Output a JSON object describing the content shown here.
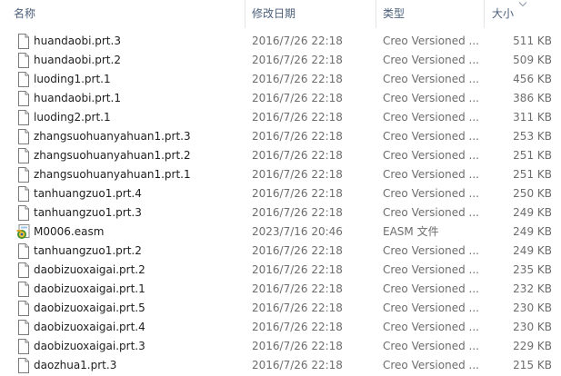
{
  "columns": {
    "name": "名称",
    "date": "修改日期",
    "type": "类型",
    "size": "大小"
  },
  "files": [
    {
      "name": "huandaobi.prt.3",
      "date": "2016/7/26 22:18",
      "type": "Creo Versioned ...",
      "size": "511 KB",
      "icon": "document-icon"
    },
    {
      "name": "huandaobi.prt.2",
      "date": "2016/7/26 22:18",
      "type": "Creo Versioned ...",
      "size": "509 KB",
      "icon": "document-icon"
    },
    {
      "name": "luoding1.prt.1",
      "date": "2016/7/26 22:18",
      "type": "Creo Versioned ...",
      "size": "456 KB",
      "icon": "document-icon"
    },
    {
      "name": "huandaobi.prt.1",
      "date": "2016/7/26 22:18",
      "type": "Creo Versioned ...",
      "size": "386 KB",
      "icon": "document-icon"
    },
    {
      "name": "luoding2.prt.1",
      "date": "2016/7/26 22:18",
      "type": "Creo Versioned ...",
      "size": "311 KB",
      "icon": "document-icon"
    },
    {
      "name": "zhangsuohuanyahuan1.prt.3",
      "date": "2016/7/26 22:18",
      "type": "Creo Versioned ...",
      "size": "253 KB",
      "icon": "document-icon"
    },
    {
      "name": "zhangsuohuanyahuan1.prt.2",
      "date": "2016/7/26 22:18",
      "type": "Creo Versioned ...",
      "size": "251 KB",
      "icon": "document-icon"
    },
    {
      "name": "zhangsuohuanyahuan1.prt.1",
      "date": "2016/7/26 22:18",
      "type": "Creo Versioned ...",
      "size": "251 KB",
      "icon": "document-icon"
    },
    {
      "name": "tanhuangzuo1.prt.4",
      "date": "2016/7/26 22:18",
      "type": "Creo Versioned ...",
      "size": "250 KB",
      "icon": "document-icon"
    },
    {
      "name": "tanhuangzuo1.prt.3",
      "date": "2016/7/26 22:18",
      "type": "Creo Versioned ...",
      "size": "249 KB",
      "icon": "document-icon"
    },
    {
      "name": "M0006.easm",
      "date": "2023/7/16 20:46",
      "type": "EASM 文件",
      "size": "249 KB",
      "icon": "easm-file-icon"
    },
    {
      "name": "tanhuangzuo1.prt.2",
      "date": "2016/7/26 22:18",
      "type": "Creo Versioned ...",
      "size": "249 KB",
      "icon": "document-icon"
    },
    {
      "name": "daobizuoxaigai.prt.2",
      "date": "2016/7/26 22:18",
      "type": "Creo Versioned ...",
      "size": "235 KB",
      "icon": "document-icon"
    },
    {
      "name": "daobizuoxaigai.prt.1",
      "date": "2016/7/26 22:18",
      "type": "Creo Versioned ...",
      "size": "232 KB",
      "icon": "document-icon"
    },
    {
      "name": "daobizuoxaigai.prt.5",
      "date": "2016/7/26 22:18",
      "type": "Creo Versioned ...",
      "size": "230 KB",
      "icon": "document-icon"
    },
    {
      "name": "daobizuoxaigai.prt.4",
      "date": "2016/7/26 22:18",
      "type": "Creo Versioned ...",
      "size": "230 KB",
      "icon": "document-icon"
    },
    {
      "name": "daobizuoxaigai.prt.3",
      "date": "2016/7/26 22:18",
      "type": "Creo Versioned ...",
      "size": "229 KB",
      "icon": "document-icon"
    },
    {
      "name": "daozhua1.prt.3",
      "date": "2016/7/26 22:18",
      "type": "Creo Versioned ...",
      "size": "215 KB",
      "icon": "document-icon"
    }
  ],
  "sort": {
    "column": "size",
    "direction": "descending",
    "icon": "chevron-down-icon"
  }
}
